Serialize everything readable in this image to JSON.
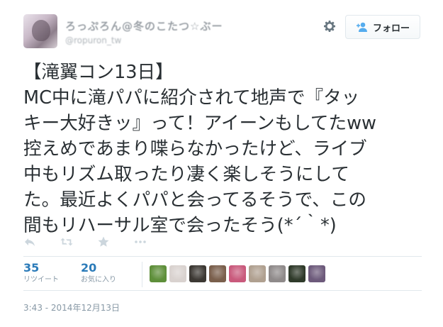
{
  "author": {
    "display_name": "ろっぷろん@冬のこたつ☆ぶー",
    "screen_name": "@ropuron_tw"
  },
  "header": {
    "follow_label": "フォロー"
  },
  "tweet": {
    "lines": [
      "【滝翼コン13日】",
      "MC中に滝パパに紹介されて地声で『タッ",
      "キー大好きッ』って！アイーンもしてたww",
      "控えめであまり喋らなかったけど、ライブ",
      "中もリズム取ったり凄く楽しそうにして",
      "た。最近よくパパと会ってるそうで、この",
      "間もリハーサル室で会ったそう(*´｀*)"
    ]
  },
  "actions": {
    "icons": [
      "reply-icon",
      "retweet-icon",
      "favorite-icon",
      "more-icon"
    ]
  },
  "stats": {
    "retweets": {
      "count": "35",
      "label": "リツイート"
    },
    "favorites": {
      "count": "20",
      "label": "お気に入り"
    }
  },
  "favoriters": {
    "colors": [
      "#5e8f3a",
      "#d9d2cf",
      "#3c3833",
      "#7a5f4c",
      "#c95a7c",
      "#b0a090",
      "#8f8a8a",
      "#2f3a2a",
      "#6d5a7b"
    ]
  },
  "timestamp": "3:43 - 2014年12月13日"
}
